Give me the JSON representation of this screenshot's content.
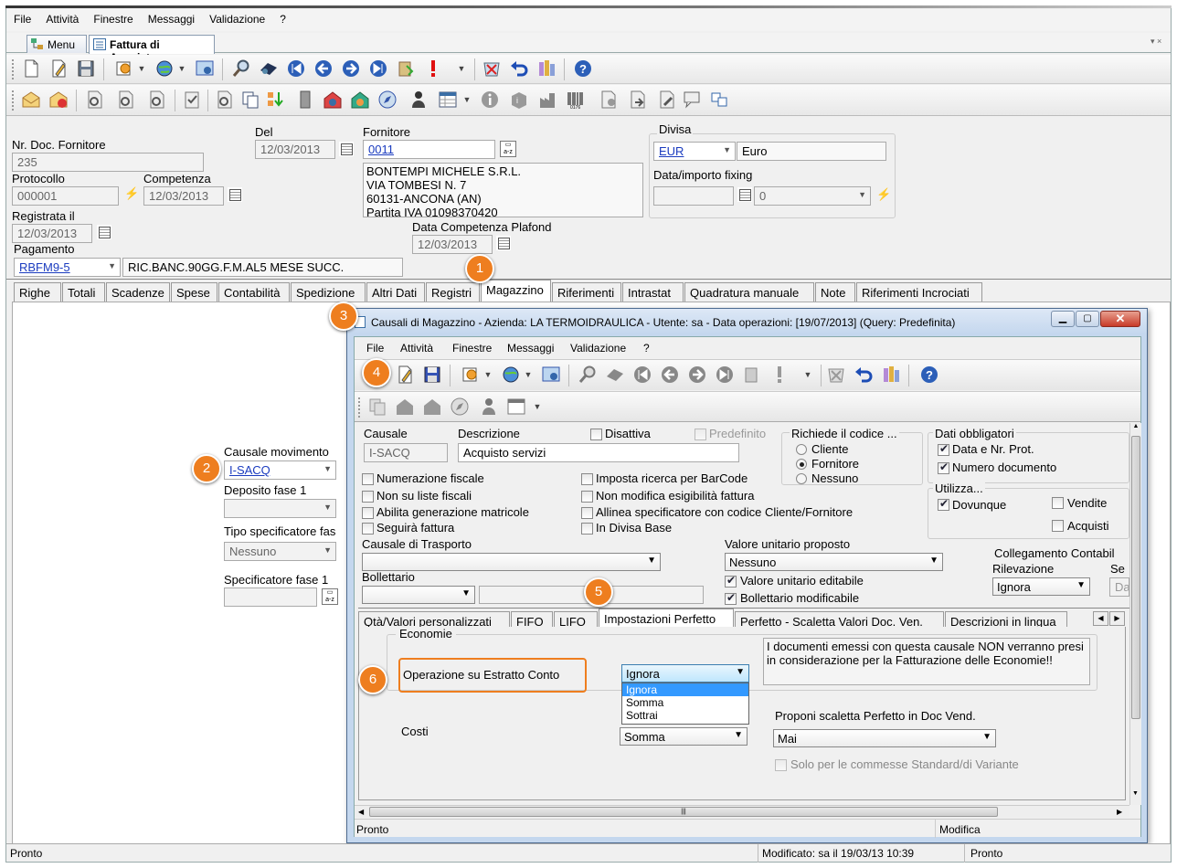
{
  "menu": [
    "File",
    "Attività",
    "Finestre",
    "Messaggi",
    "Validazione",
    "?"
  ],
  "doc_tabs": [
    {
      "label": "Menu"
    },
    {
      "label": "Fattura di Acquisto"
    }
  ],
  "form": {
    "nr_doc_label": "Nr. Doc. Fornitore",
    "nr_doc_value": "235",
    "del_label": "Del",
    "del_value": "12/03/2013",
    "protocollo_label": "Protocollo",
    "protocollo_value": "000001",
    "competenza_label": "Competenza",
    "competenza_value": "12/03/2013",
    "registrata_label": "Registrata il",
    "registrata_value": "12/03/2013",
    "pagamento_label": "Pagamento",
    "pagamento_code": "RBFM9-5",
    "pagamento_desc": "RIC.BANC.90GG.F.M.AL5 MESE SUCC.",
    "fornitore_label": "Fornitore",
    "fornitore_code": "0011",
    "fornitore_address": [
      "BONTEMPI MICHELE S.R.L.",
      "VIA TOMBESI N. 7",
      "60131-ANCONA (AN)",
      "Partita IVA 01098370420"
    ],
    "plafond_label": "Data Competenza Plafond",
    "plafond_value": "12/03/2013",
    "divisa_label": "Divisa",
    "divisa_code": "EUR",
    "divisa_desc": "Euro",
    "fixing_label": "Data/importo fixing",
    "fixing_value": "0"
  },
  "main_tabs": [
    "Righe",
    "Totali",
    "Scadenze",
    "Spese",
    "Contabilità",
    "Spedizione",
    "Altri Dati",
    "Registri",
    "Magazzino",
    "Riferimenti",
    "Intrastat",
    "Quadratura manuale",
    "Note",
    "Riferimenti Incrociati"
  ],
  "magazzino": {
    "causale_label": "Causale movimento",
    "causale_value": "I-SACQ",
    "deposito_label": "Deposito fase 1",
    "tipo_spec_label": "Tipo specificatore fas",
    "tipo_spec_value": "Nessuno",
    "spec_fase_label": "Specificatore fase 1"
  },
  "badges": [
    "1",
    "2",
    "3",
    "4",
    "5",
    "6"
  ],
  "dialog": {
    "title": "Causali di Magazzino - Azienda: LA TERMOIDRAULICA - Utente: sa - Data operazioni: [19/07/2013] (Query: Predefinita)",
    "menu": [
      "File",
      "Attività",
      "Finestre",
      "Messaggi",
      "Validazione",
      "?"
    ],
    "causale_label": "Causale",
    "causale_value": "I-SACQ",
    "descrizione_label": "Descrizione",
    "descrizione_value": "Acquisto servizi",
    "disattiva_label": "Disattiva",
    "predefinito_label": "Predefinito",
    "richiede_label": "Richiede il codice ...",
    "richiede_options": [
      "Cliente",
      "Fornitore",
      "Nessuno"
    ],
    "dati_obbl_label": "Dati obbligatori",
    "dati_obbl": [
      "Data e Nr. Prot.",
      "Numero documento"
    ],
    "checks_left": [
      "Numerazione fiscale",
      "Non su liste fiscali",
      "Abilita generazione matricole",
      "Seguirà fattura"
    ],
    "checks_right": [
      "Imposta ricerca per BarCode",
      "Non modifica esigibilità fattura",
      "Allinea specificatore con codice Cliente/Fornitore",
      "In Divisa Base"
    ],
    "utilizza_label": "Utilizza...",
    "utilizza": [
      "Dovunque",
      "Vendite",
      "Acquisti"
    ],
    "causale_trasporto_label": "Causale di Trasporto",
    "bollettario_label": "Bollettario",
    "valore_unit_label": "Valore unitario proposto",
    "valore_unit_value": "Nessuno",
    "valore_editabile": "Valore unitario editabile",
    "bollettario_modificabile": "Bollettario modificabile",
    "collegamento_label": "Collegamento Contabil",
    "rilevazione_label": "Rilevazione",
    "rilevazione_value": "Ignora",
    "se_label": "Se",
    "da_label": "Da",
    "tabs": [
      "Qtà/Valori personalizzati",
      "FIFO",
      "LIFO",
      "Impostazioni Perfetto",
      "Perfetto - Scaletta Valori Doc. Ven.",
      "Descrizioni in lingua"
    ],
    "economie_label": "Economie",
    "operazione_label": "Operazione su Estratto Conto",
    "operazione_value": "Ignora",
    "operazione_options": [
      "Ignora",
      "Somma",
      "Sottrai"
    ],
    "note_text": "I documenti emessi con questa causale NON verranno presi in considerazione per la Fatturazione delle Economie!!",
    "costi_label": "Costi",
    "costi_value": "Somma",
    "proponi_label": "Proponi scaletta Perfetto in Doc Vend.",
    "proponi_value": "Mai",
    "solo_commesse_label": "Solo per le commesse Standard/di Variante",
    "status_left": "Pronto",
    "status_right": "Modifica"
  },
  "status": {
    "left": "Pronto",
    "modified": "Modificato: sa il 19/03/13 10:39",
    "right": "Pronto"
  }
}
